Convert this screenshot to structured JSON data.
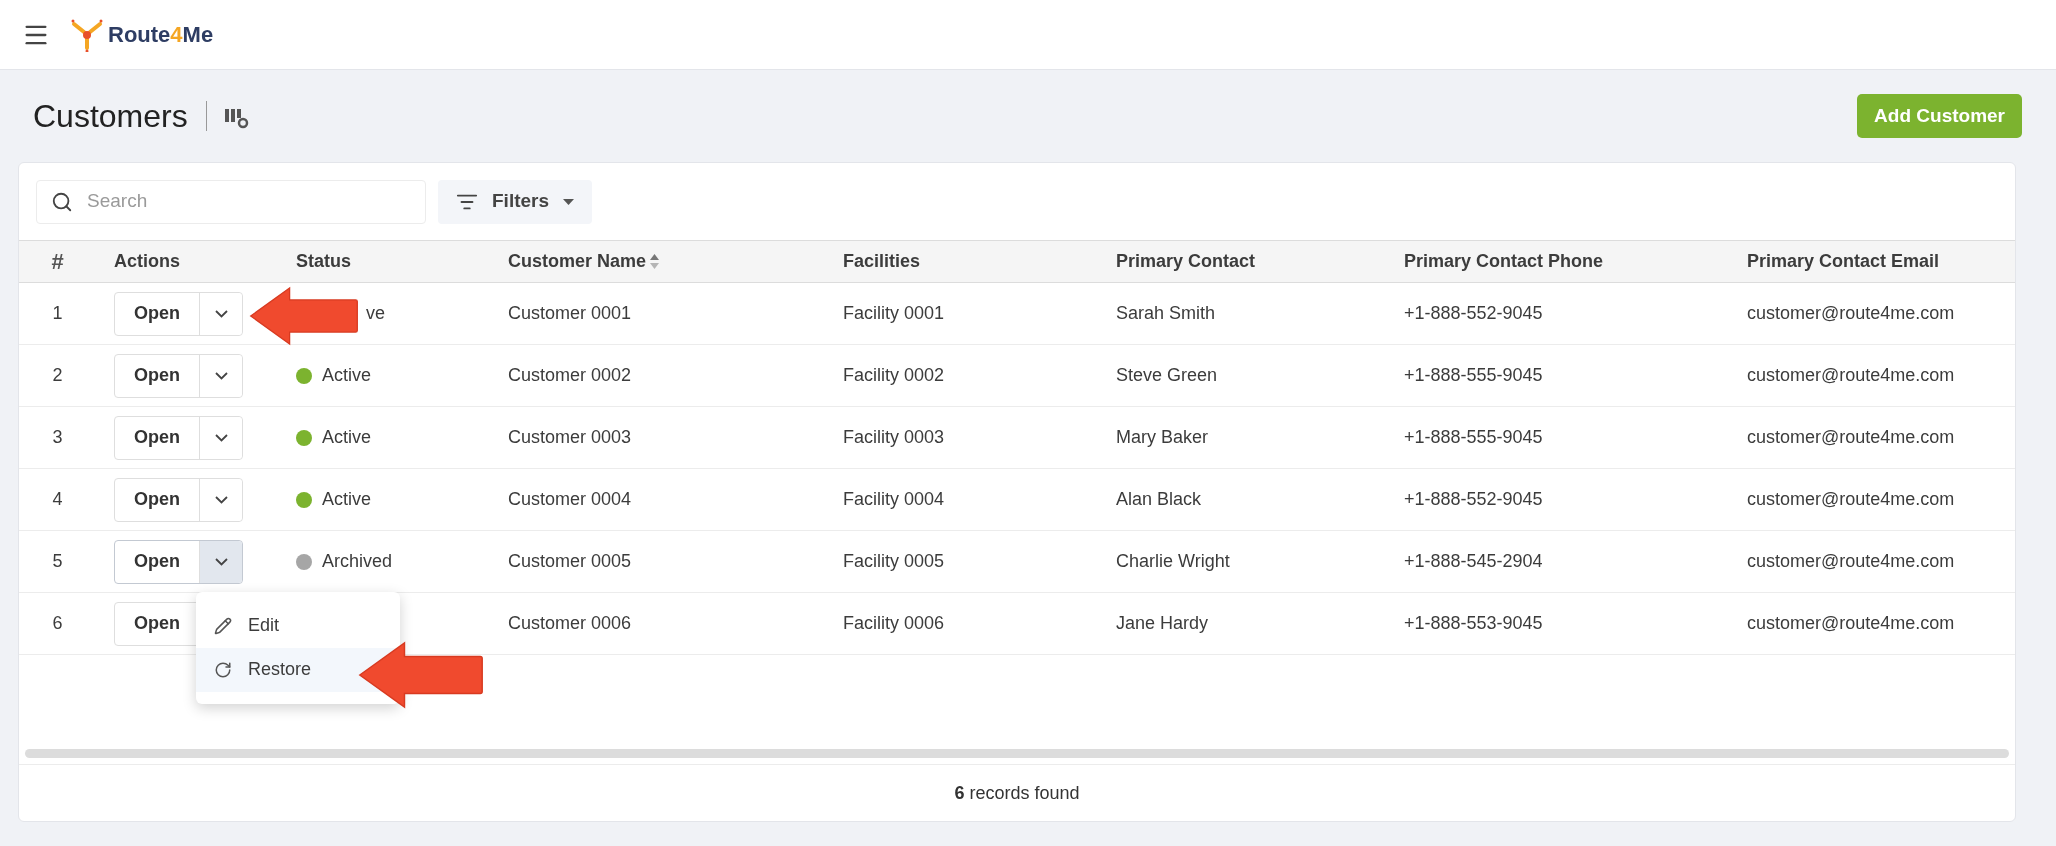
{
  "header": {
    "logo": [
      {
        "text": "Route",
        "accent": false
      },
      {
        "text": "4",
        "accent": true
      },
      {
        "text": "Me",
        "accent": false
      }
    ]
  },
  "page": {
    "title": "Customers",
    "primary_button": "Add Customer"
  },
  "toolbar": {
    "search": {
      "placeholder": "Search"
    },
    "filters_button": "Filters"
  },
  "table": {
    "columns": [
      {
        "label": "#",
        "sorted": false
      },
      {
        "label": "Actions",
        "sorted": false
      },
      {
        "label": "Status",
        "sorted": false
      },
      {
        "label": "Customer Name",
        "sorted": true
      },
      {
        "label": "Facilities",
        "sorted": false
      },
      {
        "label": "Primary Contact",
        "sorted": false
      },
      {
        "label": "Primary Contact Phone",
        "sorted": false
      },
      {
        "label": "Primary Contact Email",
        "sorted": false
      }
    ],
    "rows": [
      {
        "index": "1",
        "open": "Open",
        "menu_open": false,
        "status": "ve",
        "name": "Customer 0001",
        "facility": "Facility 0001",
        "contact": "Sarah Smith",
        "phone": "+1-888-552-9045",
        "email": "customer@route4me.com"
      },
      {
        "index": "2",
        "open": "Open",
        "menu_open": false,
        "status": "Active",
        "color": "#7cb32f",
        "name": "Customer 0002",
        "facility": "Facility 0002",
        "contact": "Steve Green",
        "phone": "+1-888-555-9045",
        "email": "customer@route4me.com"
      },
      {
        "index": "3",
        "open": "Open",
        "menu_open": false,
        "status": "Active",
        "color": "#7cb32f",
        "name": "Customer 0003",
        "facility": "Facility 0003",
        "contact": "Mary Baker",
        "phone": "+1-888-555-9045",
        "email": "customer@route4me.com"
      },
      {
        "index": "4",
        "open": "Open",
        "menu_open": false,
        "status": "Active",
        "color": "#7cb32f",
        "name": "Customer 0004",
        "facility": "Facility 0004",
        "contact": "Alan Black",
        "phone": "+1-888-552-9045",
        "email": "customer@route4me.com"
      },
      {
        "index": "5",
        "open": "Open",
        "menu_open": true,
        "status": "Archived",
        "color": "#a6a6a6",
        "name": "Customer 0005",
        "facility": "Facility 0005",
        "contact": "Charlie Wright",
        "phone": "+1-888-545-2904",
        "email": "customer@route4me.com"
      },
      {
        "index": "6",
        "open": "Open",
        "menu_open": false,
        "name": "Customer 0006",
        "facility": "Facility 0006",
        "contact": "Jane Hardy",
        "phone": "+1-888-553-9045",
        "email": "customer@route4me.com"
      }
    ],
    "row_menu": [
      {
        "kind": "edit",
        "label": "Edit",
        "selected": false
      },
      {
        "kind": "restore",
        "label": "Restore",
        "selected": true
      }
    ]
  },
  "footer": {
    "summary": "**6** records found"
  }
}
